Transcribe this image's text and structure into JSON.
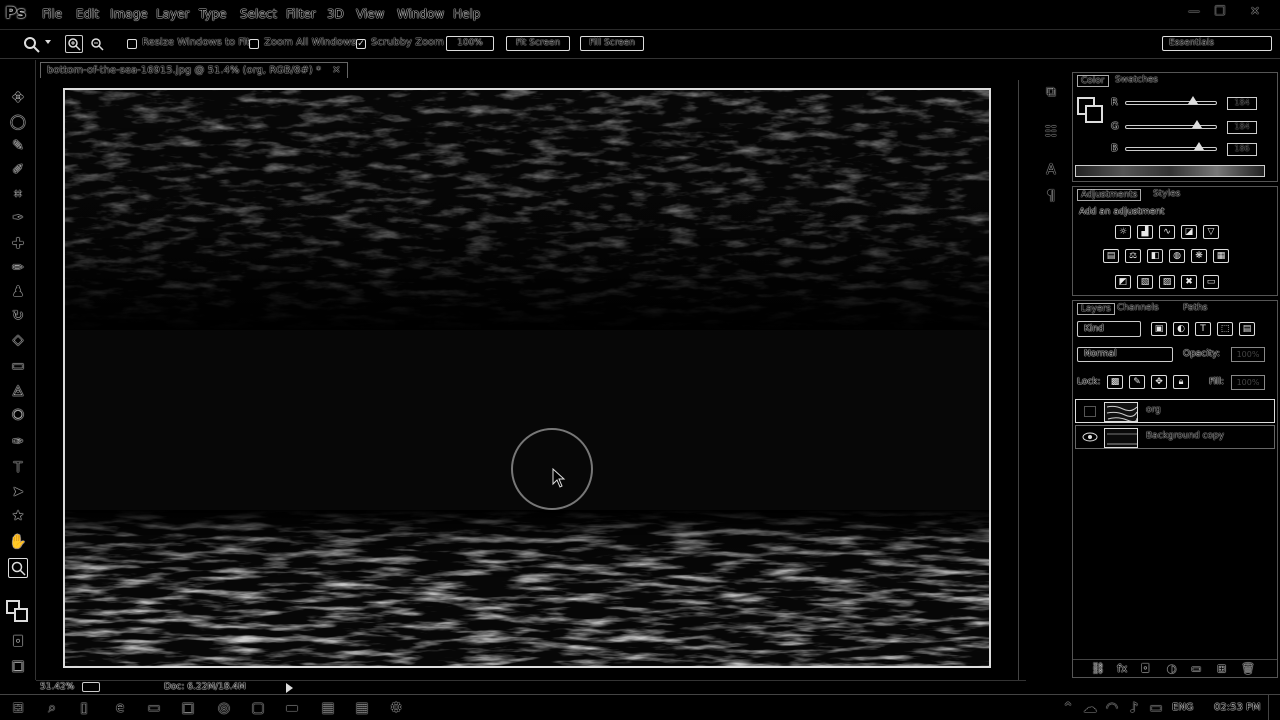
{
  "app": {
    "logo": "Ps"
  },
  "menu": [
    "File",
    "Edit",
    "Image",
    "Layer",
    "Type",
    "Select",
    "Filter",
    "3D",
    "View",
    "Window",
    "Help"
  ],
  "window_controls": {
    "minimize": "—",
    "restore": "❐",
    "close": "✕"
  },
  "options_bar": {
    "resize_windows_label": "Resize Windows to Fit",
    "zoom_all_label": "Zoom All Windows",
    "scrubby_zoom_label": "Scrubby Zoom",
    "scrubby_zoom_checked": true,
    "btn_100": "100%",
    "btn_fit": "Fit Screen",
    "btn_fill": "Fill Screen",
    "workspace": "Essentials"
  },
  "document": {
    "tab_title": "bottom-of-the-sea-16915.jpg @ 51.4% (org, RGB/8#) *"
  },
  "color_panel": {
    "tabs": [
      "Color",
      "Swatches"
    ],
    "r_label": "R",
    "g_label": "G",
    "b_label": "B",
    "r": "184",
    "g": "184",
    "b": "186"
  },
  "adjustments_panel": {
    "tabs": [
      "Adjustments",
      "Styles"
    ],
    "heading": "Add an adjustment"
  },
  "layers_panel": {
    "tabs": [
      "Layers",
      "Channels",
      "Paths"
    ],
    "kind": "Kind",
    "blend_mode": "Normal",
    "opacity_label": "Opacity:",
    "opacity": "100%",
    "lock_label": "Lock:",
    "fill_label": "Fill:",
    "fill": "100%",
    "layers": [
      {
        "name": "org",
        "visible": false,
        "selected": true
      },
      {
        "name": "Background copy",
        "visible": true,
        "selected": false
      }
    ]
  },
  "status_bar": {
    "zoom": "51.42%",
    "doc": "Doc: 6.22M/18.4M"
  },
  "taskbar": {
    "time": "02:53 PM",
    "lang": "ENG"
  }
}
